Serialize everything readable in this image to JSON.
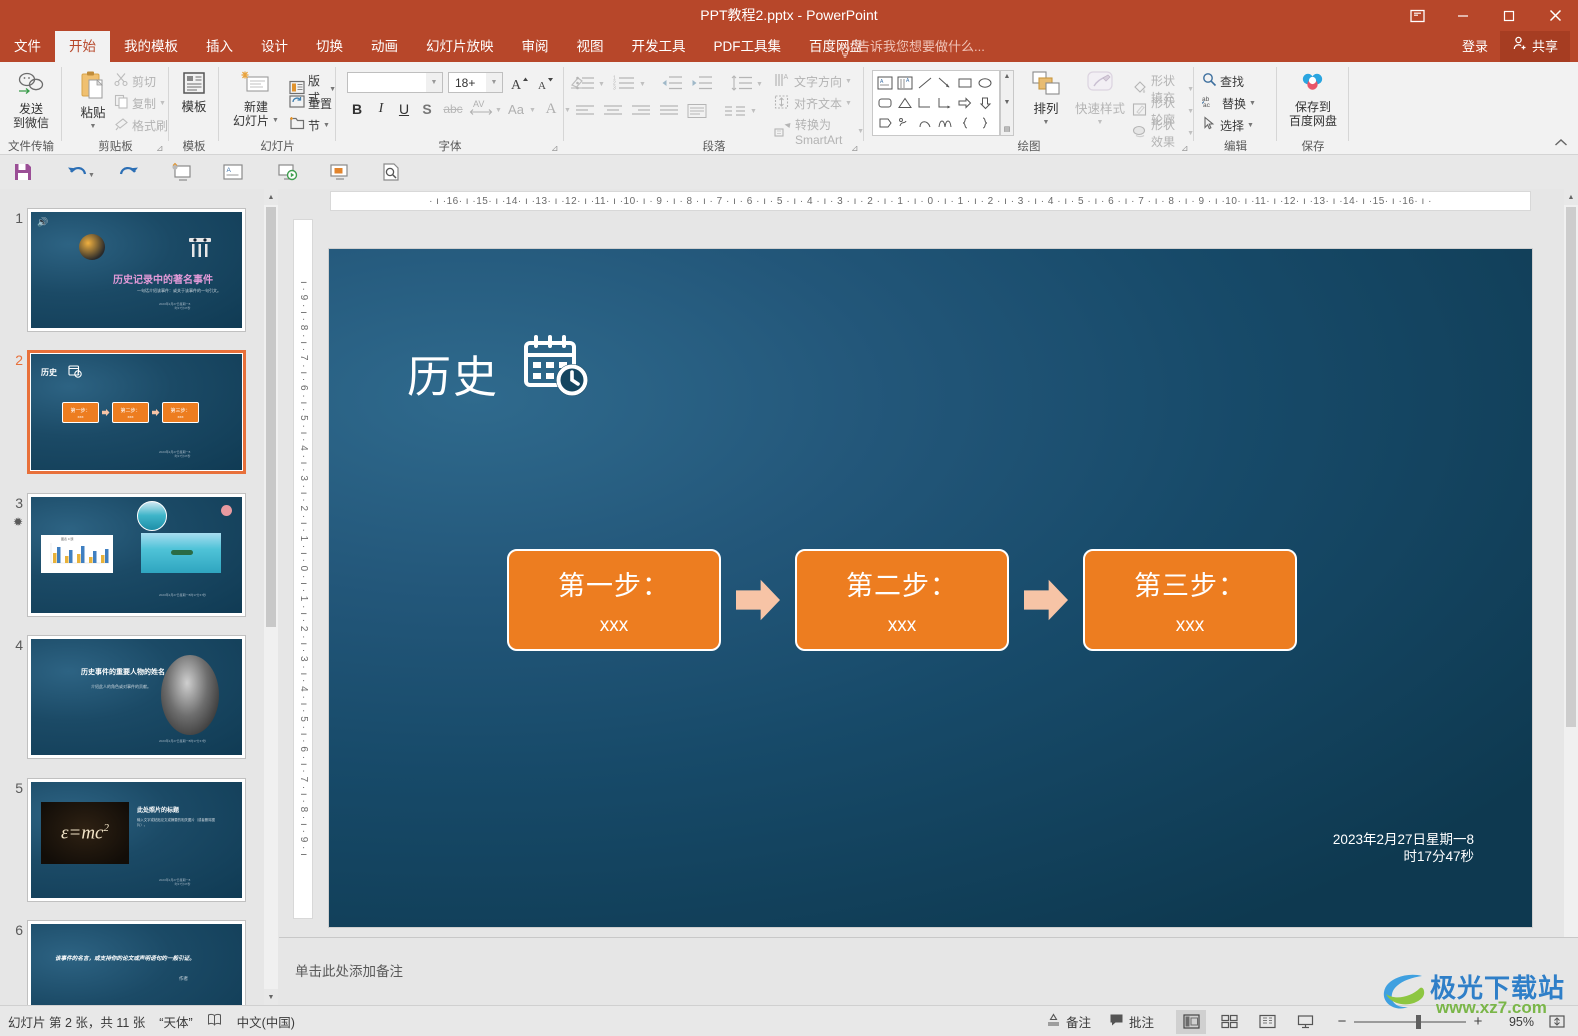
{
  "window": {
    "title": "PPT教程2.pptx - PowerPoint",
    "ribbon_display_icon": "ribbon-display-options-icon",
    "minimize": "–",
    "maximize": "□",
    "close": "✕",
    "signin_label": "登录",
    "share_label": "共享"
  },
  "tabs": [
    {
      "label": "文件",
      "active": false
    },
    {
      "label": "开始",
      "active": true
    },
    {
      "label": "我的模板",
      "active": false
    },
    {
      "label": "插入",
      "active": false
    },
    {
      "label": "设计",
      "active": false
    },
    {
      "label": "切换",
      "active": false
    },
    {
      "label": "动画",
      "active": false
    },
    {
      "label": "幻灯片放映",
      "active": false
    },
    {
      "label": "审阅",
      "active": false
    },
    {
      "label": "视图",
      "active": false
    },
    {
      "label": "开发工具",
      "active": false
    },
    {
      "label": "PDF工具集",
      "active": false
    },
    {
      "label": "百度网盘",
      "active": false
    }
  ],
  "tellme": "告诉我您想要做什么...",
  "ribbon": {
    "groups": [
      {
        "name": "file_transfer",
        "label": "文件传输"
      },
      {
        "name": "clipboard",
        "label": "剪贴板"
      },
      {
        "name": "template",
        "label": "模板"
      },
      {
        "name": "slides",
        "label": "幻灯片"
      },
      {
        "name": "font",
        "label": "字体"
      },
      {
        "name": "paragraph",
        "label": "段落"
      },
      {
        "name": "drawing",
        "label": "绘图"
      },
      {
        "name": "editing",
        "label": "编辑"
      },
      {
        "name": "save",
        "label": "保存"
      }
    ],
    "file_transfer": {
      "send_to_wechat": "发送\n到微信"
    },
    "clipboard": {
      "paste": "粘贴",
      "cut": "剪切",
      "copy": "复制",
      "format_painter": "格式刷"
    },
    "template": {
      "template_btn": "模板"
    },
    "slides": {
      "new_slide": "新建\n幻灯片",
      "layout": "版式",
      "reset": "重置",
      "section": "节"
    },
    "font": {
      "font_name_value": "",
      "font_size_value": "18+",
      "grow_font": "A",
      "shrink_font": "A",
      "clear_formatting": "clear-format-icon",
      "bold": "B",
      "italic": "I",
      "underline": "U",
      "shadow": "S",
      "strikethrough": "abc",
      "char_spacing": "AV",
      "change_case": "Aa",
      "font_color": "A"
    },
    "paragraph": {
      "text_direction": "文字方向",
      "align_text": "对齐文本",
      "convert_smartart": "转换为 SmartArt"
    },
    "drawing": {
      "arrange": "排列",
      "quick_styles": "快速样式",
      "shape_fill": "形状填充",
      "shape_outline": "形状轮廓",
      "shape_effects": "形状效果"
    },
    "editing": {
      "find": "查找",
      "replace": "替换",
      "select": "选择"
    },
    "save": {
      "save_to_baidu": "保存到\n百度网盘"
    }
  },
  "quick_access": [
    {
      "name": "save-icon"
    },
    {
      "name": "undo-icon"
    },
    {
      "name": "redo-icon"
    },
    {
      "name": "start-from-beginning-icon"
    },
    {
      "name": "insert-textbox-icon"
    },
    {
      "name": "slideshow-icon"
    },
    {
      "name": "present-icon"
    },
    {
      "name": "preview-icon"
    }
  ],
  "thumbnails": [
    {
      "number": "1",
      "starred": false,
      "selected": false,
      "kind": "title"
    },
    {
      "number": "2",
      "starred": false,
      "selected": true,
      "kind": "steps"
    },
    {
      "number": "3",
      "starred": true,
      "selected": false,
      "kind": "chart-photo"
    },
    {
      "number": "4",
      "starred": false,
      "selected": false,
      "kind": "person"
    },
    {
      "number": "5",
      "starred": false,
      "selected": false,
      "kind": "emc2"
    },
    {
      "number": "6",
      "starred": false,
      "selected": false,
      "kind": "quote"
    }
  ],
  "thumb_texts": {
    "s1_title": "历史记录中的著名事件",
    "s1_sub": "一句话介绍该事件：或关于该事件的一句引文。",
    "s2_title": "历史",
    "s4_title": "历史事件的重要人物的姓名",
    "s4_sub": "介绍此人的角色或对事件的贡献。",
    "s5_title": "此处照片的标题",
    "s5_body": "输入文字或粘贴论文或摘要的相关图片（或者删除图片）。",
    "s6_quote": "该事件的名言，或支持你的论文或声明语句的一般引证。",
    "s6_author": "作者"
  },
  "rulers": {
    "horizontal": "· ı ·16· ı ·15· ı ·14· ı ·13· ı ·12· ı ·11· ı ·10· ı · 9 · ı · 8 · ı · 7 · ı · 6 · ı · 5 · ı · 4 · ı · 3 · ı · 2 · ı · 1 · ı · 0 · ı · 1 · ı · 2 · ı · 3 · ı · 4 · ı · 5 · ı · 6 · ı · 7 · ı · 8 · ı · 9 · ı ·10· ı ·11· ı ·12· ı ·13· ı ·14· ı ·15· ı ·16· ı ·",
    "vertical": "ı · 9 · ı · 8 · ı · 7 · ı · 6 · ı · 5 · ı · 4 · ı · 3 · ı · 2 · ı · 1 · ı · 0 · ı · 1 · ı · 2 · ı · 3 · ı · 4 · ı · 5 · ı · 6 · ı · 7 · ı · 8 · ı · 9 · ı"
  },
  "slide": {
    "title": "历史",
    "title_icon": "calendar-clock-icon",
    "steps": [
      {
        "heading": "第一步：",
        "body": "xxx"
      },
      {
        "heading": "第二步：",
        "body": "xxx"
      },
      {
        "heading": "第三步：",
        "body": "xxx"
      }
    ],
    "arrow_icon": "right-arrow-icon",
    "date_line1": "2023年2月27日星期一8",
    "date_line2": "时17分47秒",
    "box_color": "#ed7d20",
    "arrow_color": "#f7c4a6",
    "background_color": "#1b5175"
  },
  "notes": {
    "placeholder": "单击此处添加备注"
  },
  "status": {
    "slide_count": "幻灯片 第 2 张，共 11 张",
    "theme": "“天体”",
    "spellcheck_icon": "spellcheck-icon",
    "language": "中文(中国)",
    "notes_label": "备注",
    "comments_label": "批注",
    "views": [
      {
        "name": "normal-view",
        "active": true
      },
      {
        "name": "slide-sorter-view",
        "active": false
      },
      {
        "name": "reading-view",
        "active": false
      },
      {
        "name": "slideshow-view",
        "active": false
      }
    ],
    "zoom_out": "−",
    "zoom_in": "+",
    "zoom_level": "95%",
    "fit_slide_icon": "fit-to-window-icon"
  },
  "watermark": {
    "name": "极光下载站",
    "url": "www.xz7.com"
  }
}
